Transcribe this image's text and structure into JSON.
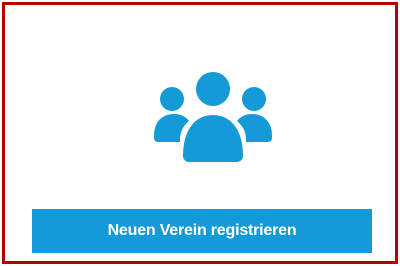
{
  "card": {
    "border_color": "#b30000",
    "icon": "users-group-icon",
    "icon_color": "#159ad8",
    "button": {
      "label": "Neuen Verein registrieren",
      "background": "#159ad8",
      "text_color": "#ffffff"
    }
  }
}
